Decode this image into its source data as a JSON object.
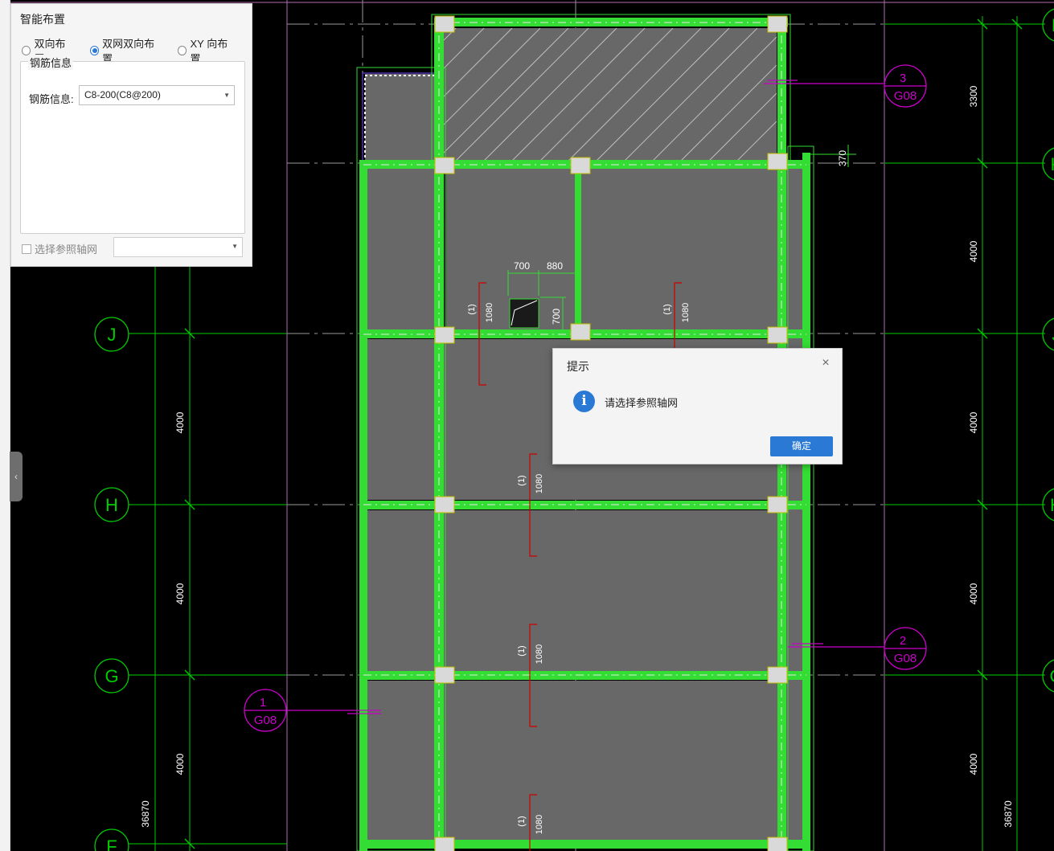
{
  "panel": {
    "title": "智能布置",
    "radios": [
      {
        "label": "双向布置",
        "selected": false
      },
      {
        "label": "双网双向布置",
        "selected": true
      },
      {
        "label": "XY 向布置",
        "selected": false
      }
    ],
    "group_title": "钢筋信息",
    "rebar_label": "钢筋信息:",
    "rebar_value": "C8-200(C8@200)",
    "ref_axis_checkbox": "选择参照轴网",
    "ref_axis_value": ""
  },
  "dialog": {
    "title": "提示",
    "message": "请选择参照轴网",
    "ok_label": "确定",
    "close_icon": "×",
    "info_icon": "i"
  },
  "drawing": {
    "axis_left": [
      "J",
      "H",
      "G",
      "F"
    ],
    "axis_right": [
      "L",
      "K",
      "J",
      "H",
      "G"
    ],
    "right_dims": [
      "3300",
      "4000",
      "4000",
      "4000",
      "4000"
    ],
    "left_dims": [
      "4000",
      "4000",
      "4000"
    ],
    "total_dim": "36870",
    "slab_marks": [
      "(1)",
      "1080"
    ],
    "opening_dims": [
      "700",
      "880",
      "700"
    ],
    "small_dim": "370",
    "section_marks": [
      {
        "num": "3",
        "sheet": "G08"
      },
      {
        "num": "2",
        "sheet": "G08"
      },
      {
        "num": "1",
        "sheet": "G08"
      }
    ],
    "colors": {
      "beam": "#33dd33",
      "slab": "#686868",
      "axis": "#00cc00",
      "section": "#cc00cc",
      "dim_red": "#cc0000",
      "column": "#d9d9d9",
      "accent": "#2a7ad5"
    }
  }
}
